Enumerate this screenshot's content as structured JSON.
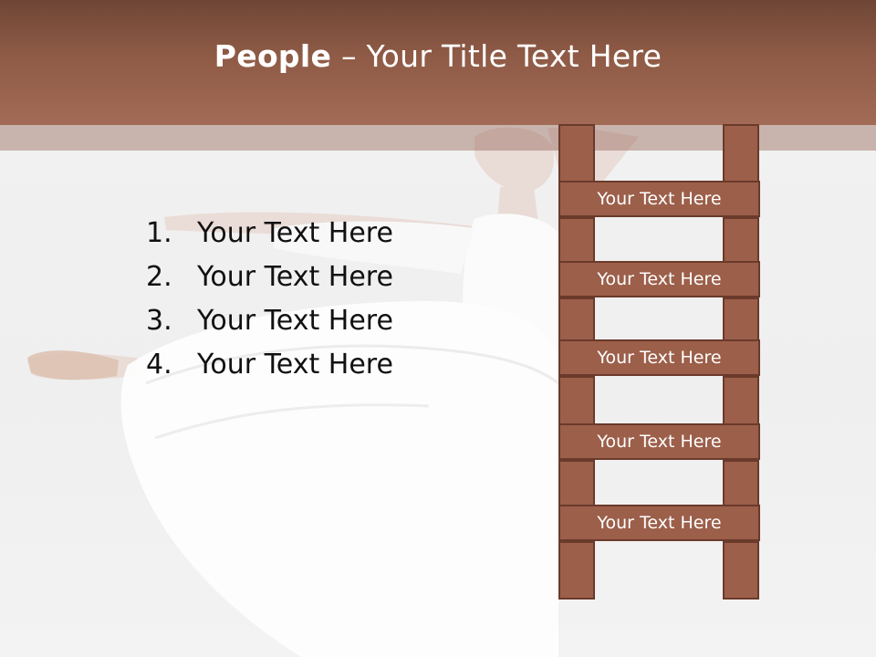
{
  "header": {
    "title_bold": "People",
    "title_rest": " – Your Title Text Here"
  },
  "list": [
    {
      "number": "1.",
      "text": "Your Text Here"
    },
    {
      "number": "2.",
      "text": "Your Text Here"
    },
    {
      "number": "3.",
      "text": "Your Text Here"
    },
    {
      "number": "4.",
      "text": "Your Text Here"
    }
  ],
  "ladder": {
    "rungs": [
      "Your Text Here",
      "Your Text Here",
      "Your Text Here",
      "Your Text Here",
      "Your Text Here"
    ]
  },
  "colors": {
    "header_top": "#6e4636",
    "header_bottom": "#a26b55",
    "ladder_fill": "#9c5f4a",
    "ladder_border": "#6a3a2b"
  }
}
